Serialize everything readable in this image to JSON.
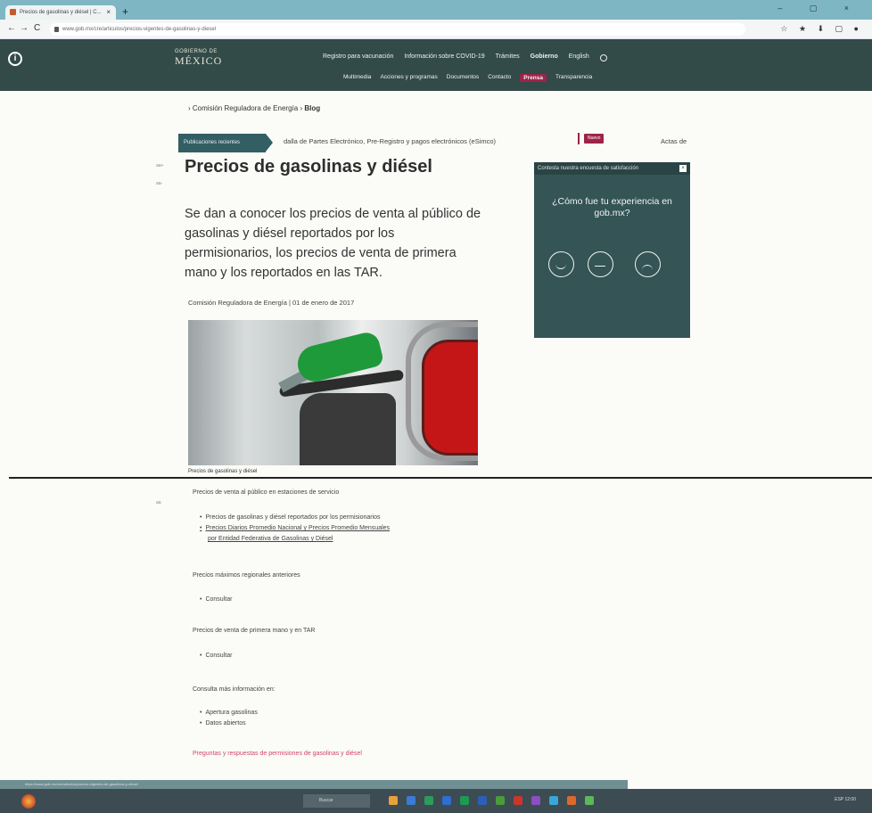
{
  "browser": {
    "tab_title": "Precios de gasolinas y diésel | C...",
    "tab_close": "×",
    "new_tab": "+",
    "url": "www.gob.mx/cre/articulos/precios-vigentes-de-gasolinas-y-diesel",
    "nav": {
      "back": "←",
      "forward": "→",
      "reload": "C"
    },
    "window_controls": "– ▢ ×",
    "extensions": "☆ ★ ⬇ ▢ ●"
  },
  "header": {
    "logo_small": "GOBIERNO DE",
    "logo_big": "MÉXICO",
    "nav_primary": [
      {
        "label": "Registro para vacunación",
        "active": false
      },
      {
        "label": "Información sobre COVID-19",
        "active": false
      },
      {
        "label": "Trámites",
        "active": false
      },
      {
        "label": "Gobierno",
        "active": true
      },
      {
        "label": "English",
        "active": false
      }
    ],
    "nav_secondary": [
      {
        "label": "Multimedia",
        "highlight": false
      },
      {
        "label": "Acciones y programas",
        "highlight": false
      },
      {
        "label": "Documentos",
        "highlight": false
      },
      {
        "label": "Contacto",
        "highlight": false
      },
      {
        "label": "Prensa",
        "highlight": true
      },
      {
        "label": "Transparencia",
        "highlight": false
      }
    ]
  },
  "breadcrumb": {
    "prefix": "›",
    "org": "Comisión Reguladora de Energía",
    "sep": "›",
    "current": "Blog"
  },
  "recent": {
    "badge": "Publicaciones recientes",
    "ticker": "dalla de Partes Electrónico, Pre-Registro y pagos electrónicos (eSimco)",
    "new_label": "Nuevo",
    "right_text": "Actas de"
  },
  "side_marks": {
    "a": "aa+",
    "b": "aa-",
    "c": "aa"
  },
  "article": {
    "title": "Precios de gasolinas y diésel",
    "lead": "Se dan a conocer los precios de venta al público de gasolinas y diésel reportados por los permisionarios, los precios de venta de primera mano y los reportados en las TAR.",
    "byline": "Comisión Reguladora de Energía | 01 de enero de 2017",
    "caption": "Precios de gasolinas y diésel"
  },
  "survey": {
    "header": "Contesta nuestra encuesta de satisfacción",
    "close": "×",
    "question": "¿Cómo fue tu experiencia en gob.mx?"
  },
  "content": {
    "section1_label": "Precios de venta al público en estaciones de servicio",
    "section1_items": [
      "Precios de gasolinas y diésel reportados por los permisionarios",
      "Precios Diarios Promedio Nacional y Precios Promedio Mensuales"
    ],
    "section1_item2_cont": "por Entidad Federativa de Gasolinas y Diésel",
    "section2_label": "Precios máximos regionales anteriores",
    "section2_item": "Consultar",
    "section3_label": "Precios de venta de primera mano y en TAR",
    "section3_item": "Consultar",
    "section4_label": "Consulta más información en:",
    "section4_items": [
      "Apertura gasolinas",
      "Datos abiertos"
    ],
    "faq_link": "Preguntas y respuestas de permisiones de gasolinas y diésel"
  },
  "statusbar": {
    "url": "https://www.gob.mx/cre/articulos/precios-vigentes-de-gasolinas-y-diesel"
  },
  "taskbar": {
    "search_placeholder": "Buscar",
    "tray": "ESP 12:00"
  }
}
